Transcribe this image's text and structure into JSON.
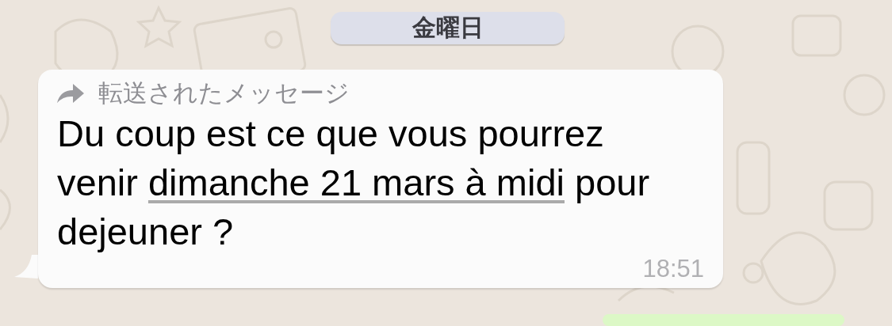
{
  "date_separator": {
    "label": "金曜日"
  },
  "messages": [
    {
      "kind": "incoming",
      "forwarded": true,
      "forwarded_label": "転送されたメッセージ",
      "text_before": "Du coup est ce que vous pourrez venir",
      "link": "dimanche 21 mars à midi",
      "text_after": "pour dejeuner ?",
      "time": "18:51"
    },
    {
      "kind": "outgoing"
    }
  ]
}
